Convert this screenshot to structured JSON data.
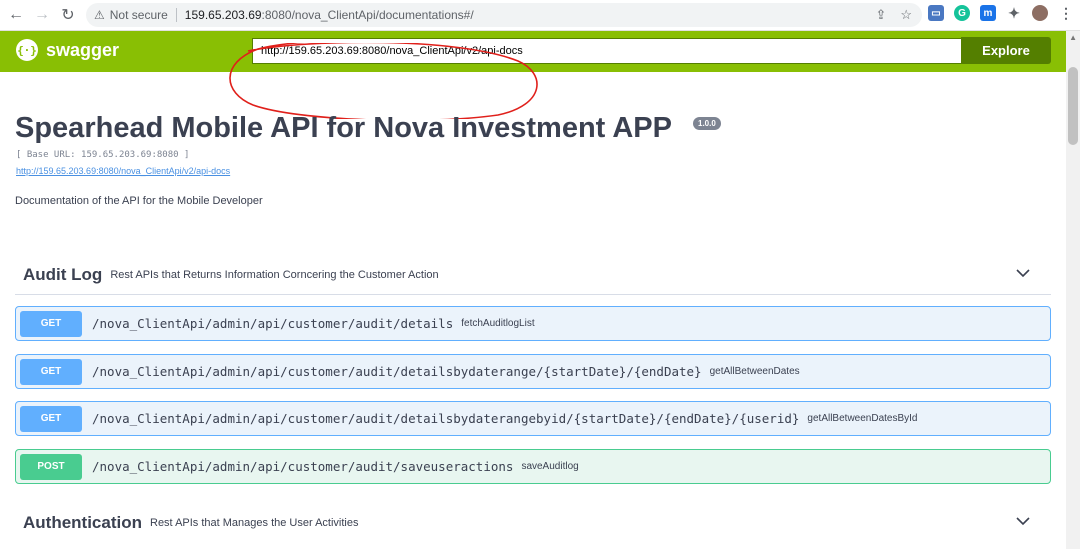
{
  "browser": {
    "security_label": "Not secure",
    "url_host": "159.65.203.69",
    "url_rest": ":8080/nova_ClientApi/documentations#/"
  },
  "swagger": {
    "logo_text": "swagger",
    "logo_glyph": "{···}",
    "api_url": "http://159.65.203.69:8080/nova_ClientApi/v2/api-docs",
    "explore_label": "Explore"
  },
  "info": {
    "title": "Spearhead Mobile API for Nova Investment APP",
    "version": "1.0.0",
    "base_url": "[ Base URL: 159.65.203.69:8080 ]",
    "docs_link": "http://159.65.203.69:8080/nova_ClientApi/v2/api-docs",
    "description": "Documentation of the API for the Mobile Developer"
  },
  "sections": [
    {
      "name": "Audit Log",
      "description": "Rest APIs that Returns Information Corncering the Customer Action",
      "operations": [
        {
          "method": "GET",
          "path": "/nova_ClientApi/admin/api/customer/audit/details",
          "summary": "fetchAuditlogList"
        },
        {
          "method": "GET",
          "path": "/nova_ClientApi/admin/api/customer/audit/detailsbydaterange/{startDate}/{endDate}",
          "summary": "getAllBetweenDates"
        },
        {
          "method": "GET",
          "path": "/nova_ClientApi/admin/api/customer/audit/detailsbydaterangebyid/{startDate}/{endDate}/{userid}",
          "summary": "getAllBetweenDatesById"
        },
        {
          "method": "POST",
          "path": "/nova_ClientApi/admin/api/customer/audit/saveuseractions",
          "summary": "saveAuditlog"
        }
      ]
    },
    {
      "name": "Authentication",
      "description": "Rest APIs that Manages the User Activities"
    }
  ],
  "colors": {
    "swagger_green": "#89bf04",
    "explore_green": "#547f00",
    "get_blue": "#61affe",
    "post_green": "#49cc90",
    "annotation_red": "#e0201b"
  },
  "icons": [
    "back-arrow-icon",
    "forward-arrow-icon",
    "reload-icon",
    "warning-icon",
    "share-icon",
    "star-icon",
    "extension-icon",
    "chevron-down-icon",
    "more-vert-icon"
  ]
}
